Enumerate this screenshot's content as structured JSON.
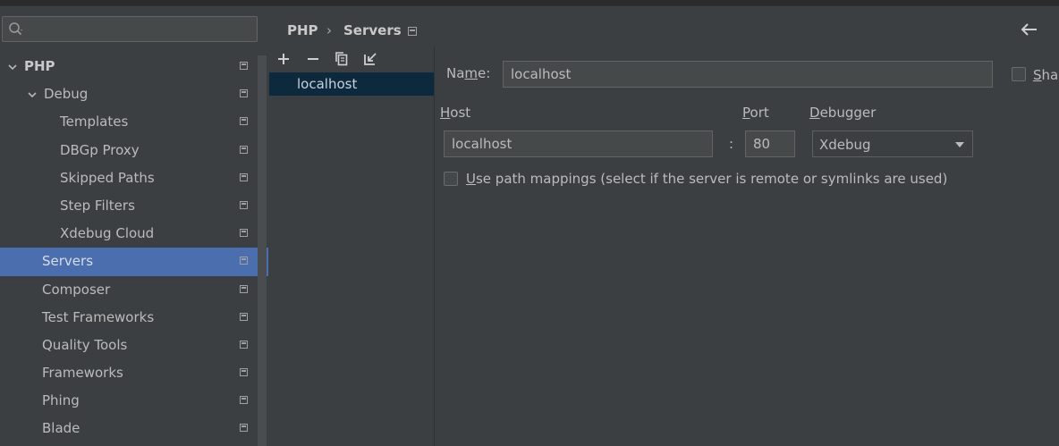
{
  "search": {
    "value": "",
    "placeholder": ""
  },
  "tree": [
    {
      "label": "PHP",
      "level": 0,
      "expanded": true,
      "bold": true,
      "selected": false
    },
    {
      "label": "Debug",
      "level": 1,
      "expanded": true,
      "bold": false,
      "selected": false
    },
    {
      "label": "Templates",
      "level": 2,
      "selected": false
    },
    {
      "label": "DBGp Proxy",
      "level": 2,
      "selected": false
    },
    {
      "label": "Skipped Paths",
      "level": 2,
      "selected": false
    },
    {
      "label": "Step Filters",
      "level": 2,
      "selected": false
    },
    {
      "label": "Xdebug Cloud",
      "level": 2,
      "selected": false
    },
    {
      "label": "Servers",
      "level": 1,
      "selected": true
    },
    {
      "label": "Composer",
      "level": 1,
      "selected": false
    },
    {
      "label": "Test Frameworks",
      "level": 1,
      "selected": false
    },
    {
      "label": "Quality Tools",
      "level": 1,
      "selected": false
    },
    {
      "label": "Frameworks",
      "level": 1,
      "selected": false
    },
    {
      "label": "Phing",
      "level": 1,
      "selected": false
    },
    {
      "label": "Blade",
      "level": 1,
      "selected": false
    }
  ],
  "breadcrumb": {
    "parent": "PHP",
    "separator": "›",
    "current": "Servers"
  },
  "toolbar": {
    "add": "add-icon",
    "remove": "remove-icon",
    "copy": "copy-icon",
    "import": "import-icon"
  },
  "servers": [
    "localhost"
  ],
  "form": {
    "name_label": "Name:",
    "name_value": "localhost",
    "shared_label": "Shared",
    "host_label": "Host",
    "port_label": "Port",
    "debugger_label": "Debugger",
    "host_value": "localhost",
    "colon": ":",
    "port_value": "80",
    "debugger_value": "Xdebug",
    "mappings_label": "Use path mappings (select if the server is remote or symlinks are used)"
  },
  "colors": {
    "background": "#3c3f41",
    "selection": "#4b6eaf",
    "list_selection": "#0d293e",
    "field": "#45494a"
  }
}
